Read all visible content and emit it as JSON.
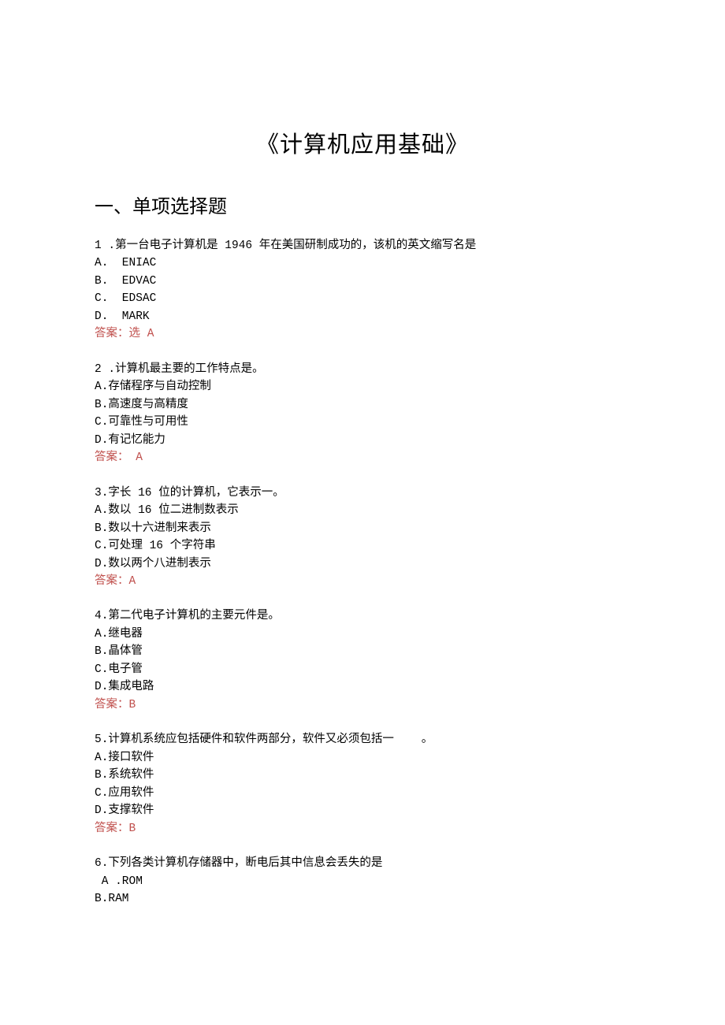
{
  "title": "《计算机应用基础》",
  "section_heading": "一、单项选择题",
  "questions": [
    {
      "stem": "1 .第一台电子计算机是 1946 年在美国研制成功的，该机的英文缩写名是",
      "options": [
        "A.  ENIAC",
        "B.  EDVAC",
        "C.  EDSAC",
        "D.  MARK"
      ],
      "answer": "答案：选 A"
    },
    {
      "stem": "2 .计算机最主要的工作特点是。",
      "options": [
        "A.存储程序与自动控制",
        "B.高速度与高精度",
        "C.可靠性与可用性",
        "D.有记忆能力"
      ],
      "answer": "答案： A"
    },
    {
      "stem": "3.字长 16 位的计算机，它表示一。",
      "options": [
        "A.数以 16 位二进制数表示",
        "B.数以十六进制来表示",
        "C.可处理 16 个字符串",
        "D.数以两个八进制表示"
      ],
      "answer": "答案：A"
    },
    {
      "stem": "4.第二代电子计算机的主要元件是。",
      "options": [
        "A.继电器",
        "B.晶体管",
        "C.电子管",
        "D.集成电路"
      ],
      "answer": "答案：B"
    },
    {
      "stem": "5.计算机系统应包括硬件和软件两部分，软件又必须包括一    。",
      "options": [
        "A.接口软件",
        "B.系统软件",
        "C.应用软件",
        "D.支撑软件"
      ],
      "answer": "答案：B"
    },
    {
      "stem": "6.下列各类计算机存储器中，断电后其中信息会丢失的是",
      "options": [
        " A .ROM",
        "B.RAM"
      ],
      "answer": ""
    }
  ]
}
